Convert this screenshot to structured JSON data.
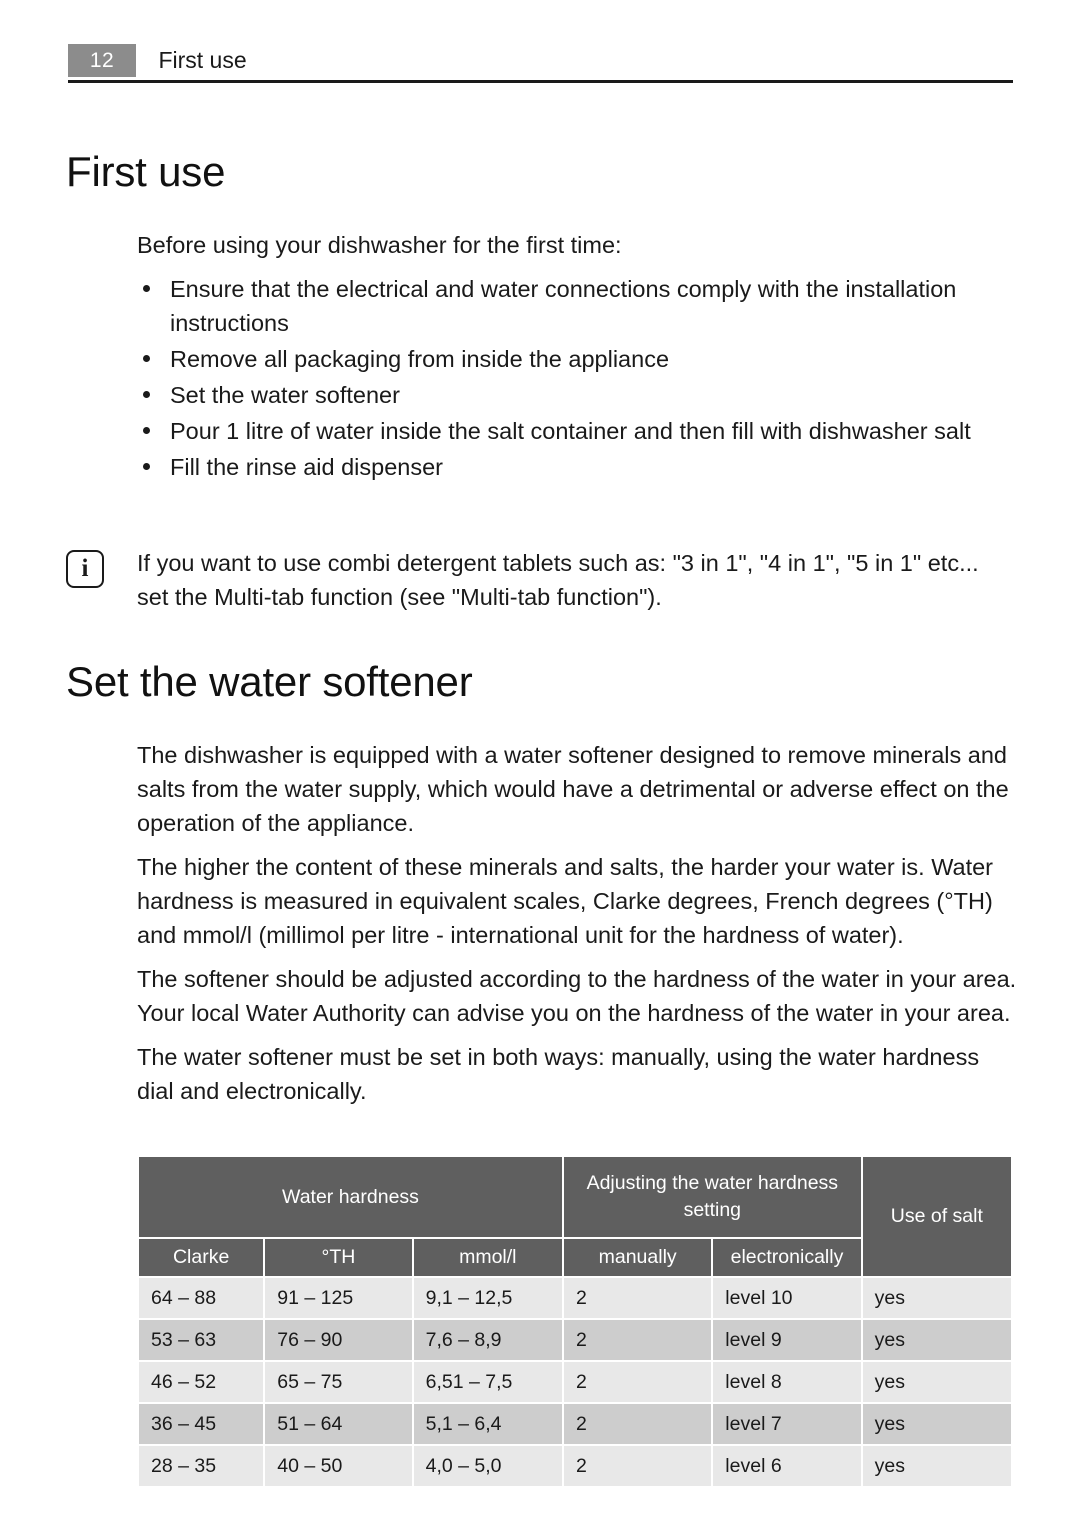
{
  "header": {
    "page_number": "12",
    "running_title": "First use"
  },
  "sections": [
    {
      "id": "first-use",
      "heading": "First use",
      "intro": "Before using your dishwasher for the first time:",
      "bullets": [
        "Ensure that the electrical and water connections comply with the installation instructions",
        "Remove all packaging from inside the appliance",
        "Set the water softener",
        "Pour 1 litre of water inside the salt container and then fill with dishwasher salt",
        "Fill the rinse aid dispenser"
      ]
    },
    {
      "id": "water-softener",
      "heading": "Set the water softener",
      "paragraphs": [
        "The dishwasher is equipped with a water softener designed to remove minerals and salts from the water supply, which would have a detrimental or adverse effect on the operation of the appliance.",
        "The higher the content of these minerals and salts, the harder your water is. Water hardness is measured in equivalent scales, Clarke degrees, French degrees (°TH) and mmol/l (millimol per litre - international unit for the hardness of water).",
        "The softener should be adjusted according to the hardness of the water in your area. Your local Water Authority can advise you on the hardness of the water in your area.",
        "The water softener must be set in both ways: manually, using the water hardness dial and electronically."
      ]
    }
  ],
  "note": {
    "icon": "info-icon",
    "icon_glyph": "i",
    "text": "If you want to use combi detergent tablets such as: \"3 in 1\", \"4 in 1\", \"5 in 1\" etc... set the Multi-tab function (see \"Multi-tab function\")."
  },
  "table": {
    "group_headers": [
      {
        "label": "Water hardness",
        "colspan": 3
      },
      {
        "label": "Adjusting the water hardness setting",
        "colspan": 2
      },
      {
        "label": "Use of salt",
        "colspan": 1,
        "rowspan": 2
      }
    ],
    "sub_headers": [
      "Clarke",
      "°TH",
      "mmol/l",
      "manually",
      "electronically"
    ],
    "rows": [
      [
        "64 – 88",
        "91 – 125",
        "9,1 – 12,5",
        "2",
        "level 10",
        "yes"
      ],
      [
        "53 – 63",
        "76 – 90",
        "7,6 – 8,9",
        "2",
        "level 9",
        "yes"
      ],
      [
        "46 – 52",
        "65 – 75",
        "6,51 – 7,5",
        "2",
        "level 8",
        "yes"
      ],
      [
        "36 – 45",
        "51 – 64",
        "5,1 – 6,4",
        "2",
        "level 7",
        "yes"
      ],
      [
        "28 – 35",
        "40 – 50",
        "4,0 – 5,0",
        "2",
        "level 6",
        "yes"
      ]
    ]
  },
  "colors": {
    "page_number_bg": "#8c8c8c",
    "table_header_bg": "#5f5f5f",
    "row_light": "#e8e8e8",
    "row_dark": "#cdcdcd",
    "rule": "#1a1a1a"
  }
}
